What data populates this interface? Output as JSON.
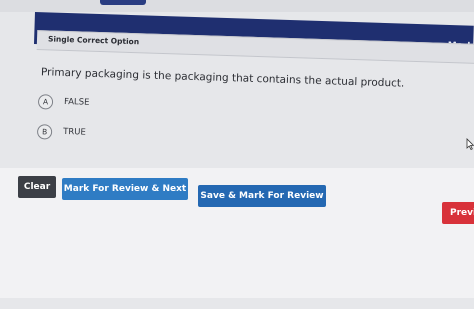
{
  "header": {
    "mark_text": "Mark"
  },
  "question": {
    "type_label": "Single Correct Option",
    "text": "Primary packaging is the packaging that contains the actual product.",
    "options": [
      {
        "key": "A",
        "label": "FALSE"
      },
      {
        "key": "B",
        "label": "TRUE"
      }
    ]
  },
  "actions": {
    "clear": "Clear",
    "mark_review_next": "Mark For Review & Next",
    "save_mark_review": "Save & Mark For Review",
    "previous": "Previ"
  },
  "colors": {
    "nav": "#1f2f70",
    "clear_button": "#3c3f46",
    "review_button": "#2f7cc4",
    "save_button": "#2468b2",
    "previous_button": "#d8323a"
  },
  "icons": {
    "cursor": "mouse-pointer-icon"
  }
}
